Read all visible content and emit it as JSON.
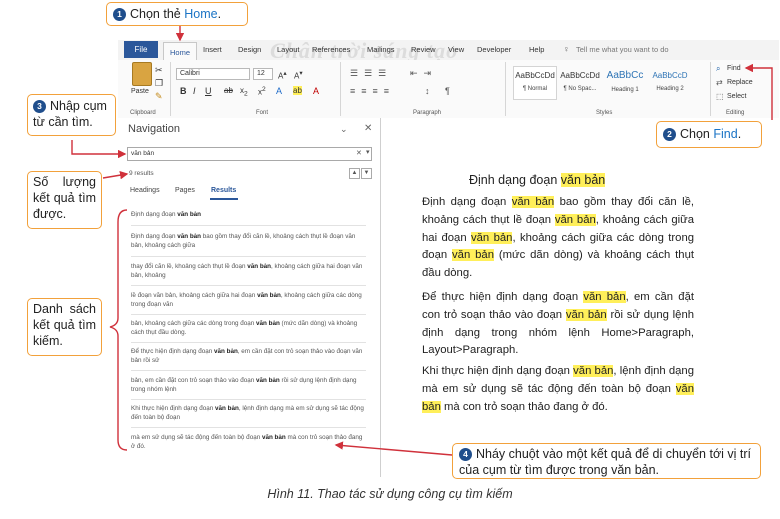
{
  "watermark": "Chân trời sáng tạo",
  "tabs": {
    "file": "File",
    "home": "Home",
    "others": [
      "Insert",
      "Design",
      "Layout",
      "References",
      "Mailings",
      "Review",
      "View",
      "Developer",
      "Help"
    ],
    "tell_me": "Tell me what you want to do"
  },
  "ribbon": {
    "clipboard": {
      "paste": "Paste",
      "label": "Clipboard"
    },
    "font": {
      "name": "Calibri",
      "size": "12",
      "label": "Font"
    },
    "paragraph": {
      "label": "Paragraph"
    },
    "styles": {
      "label": "Styles",
      "items": [
        {
          "sample": "AaBbCcDd",
          "name": "¶ Normal"
        },
        {
          "sample": "AaBbCcDd",
          "name": "¶ No Spac..."
        },
        {
          "sample": "AaBbCc",
          "name": "Heading 1"
        },
        {
          "sample": "AaBbCcD",
          "name": "Heading 2"
        }
      ]
    },
    "editing": {
      "find": "Find",
      "replace": "Replace",
      "select": "Select",
      "label": "Editing"
    }
  },
  "navigation": {
    "title": "Navigation",
    "search_value": "văn bản",
    "results_count": "9 results",
    "tabs": [
      "Headings",
      "Pages",
      "Results"
    ],
    "results": [
      {
        "before": "Định dạng đoạn ",
        "term": "văn bản",
        "after": ""
      },
      {
        "before": "Định dạng đoạn ",
        "term": "văn bản",
        "after": " bao gồm thay đổi căn lề, khoảng cách thụt lề đoạn văn bản, khoảng cách giữa"
      },
      {
        "before": "thay đổi căn lề, khoảng cách thụt lề đoạn ",
        "term": "văn bản",
        "after": ", khoảng cách giữa hai đoạn văn bản, khoảng"
      },
      {
        "before": "lề đoạn văn bản, khoảng cách giữa hai đoạn ",
        "term": "văn bản",
        "after": ", khoảng cách giữa các dòng trong đoạn văn"
      },
      {
        "before": "bản, khoảng cách giữa các dòng trong đoạn ",
        "term": "văn bản",
        "after": " (mức dãn dòng) và khoảng cách thụt đầu dòng."
      },
      {
        "before": "Để thực hiện định dạng đoạn ",
        "term": "văn bản",
        "after": ", em cần đặt con trỏ soạn thảo vào đoạn văn bản rồi sử"
      },
      {
        "before": "bản, em cần đặt con trỏ soạn thảo vào đoạn ",
        "term": "văn bản",
        "after": " rồi sử dụng lệnh định dạng trong nhóm lệnh"
      },
      {
        "before": "Khi thực hiện định dạng đoạn ",
        "term": "văn bản",
        "after": ", lệnh định dạng mà em sử dụng sẽ tác động đến toàn bộ đoạn"
      },
      {
        "before": "mà em sử dụng sẽ tác động đến toàn bộ đoạn ",
        "term": "văn bản",
        "after": " mà con trỏ soạn thảo đang ở đó."
      }
    ]
  },
  "document": {
    "title_before": "Định dạng đoạn ",
    "title_term": "văn bản",
    "paragraphs": [
      [
        {
          "t": "Định dạng đoạn "
        },
        {
          "t": "văn bản",
          "hl": true
        },
        {
          "t": " bao gồm thay đổi căn lề, khoảng cách thụt lề đoạn "
        },
        {
          "t": "văn bản",
          "hl": true
        },
        {
          "t": ", khoảng cách giữa hai đoạn "
        },
        {
          "t": "văn bản",
          "hl": true
        },
        {
          "t": ", khoảng cách giữa các dòng trong đoạn "
        },
        {
          "t": "văn bản",
          "hl": true
        },
        {
          "t": " (mức dãn dòng) và khoảng cách thụt đầu dòng."
        }
      ],
      [
        {
          "t": "Để thực hiện định dạng đoạn "
        },
        {
          "t": "văn bản",
          "hl": true
        },
        {
          "t": ", em cần đặt con trỏ soạn thảo vào đoạn "
        },
        {
          "t": "văn bản",
          "hl": true
        },
        {
          "t": " rồi sử dụng lệnh định dạng trong nhóm lệnh Home>Paragraph, Layout>Paragraph."
        }
      ],
      [
        {
          "t": "Khi thực hiện định dạng đoạn "
        },
        {
          "t": "văn bản",
          "hl": true
        },
        {
          "t": ", lệnh định dạng mà em sử dụng sẽ tác động đến toàn bộ đoạn "
        },
        {
          "t": "văn bản",
          "hl": true
        },
        {
          "t": " mà con trỏ soạn thảo đang ở đó."
        }
      ]
    ]
  },
  "callouts": {
    "c1": {
      "num": "1",
      "text": "Chọn thẻ ",
      "link": "Home",
      "end": "."
    },
    "c2": {
      "num": "2",
      "text": "Chọn ",
      "link": "Find",
      "end": "."
    },
    "c3": {
      "num": "3",
      "text": "Nhập cụm từ cần tìm."
    },
    "c_count": {
      "text": "Số lượng kết quả tìm được."
    },
    "c_list": {
      "text": "Danh sách kết quả tìm kiếm."
    },
    "c4": {
      "num": "4",
      "text": "Nháy chuột vào một kết quả để di chuyển tới vị trí của cụm từ tìm được trong văn bản."
    }
  },
  "caption": "Hình 11. Thao tác sử dụng công cụ tìm kiếm",
  "colors": {
    "accent": "#2b579a",
    "callout_border": "#f2a13b",
    "arrow": "#d0313b",
    "highlight": "#ffef5a"
  }
}
